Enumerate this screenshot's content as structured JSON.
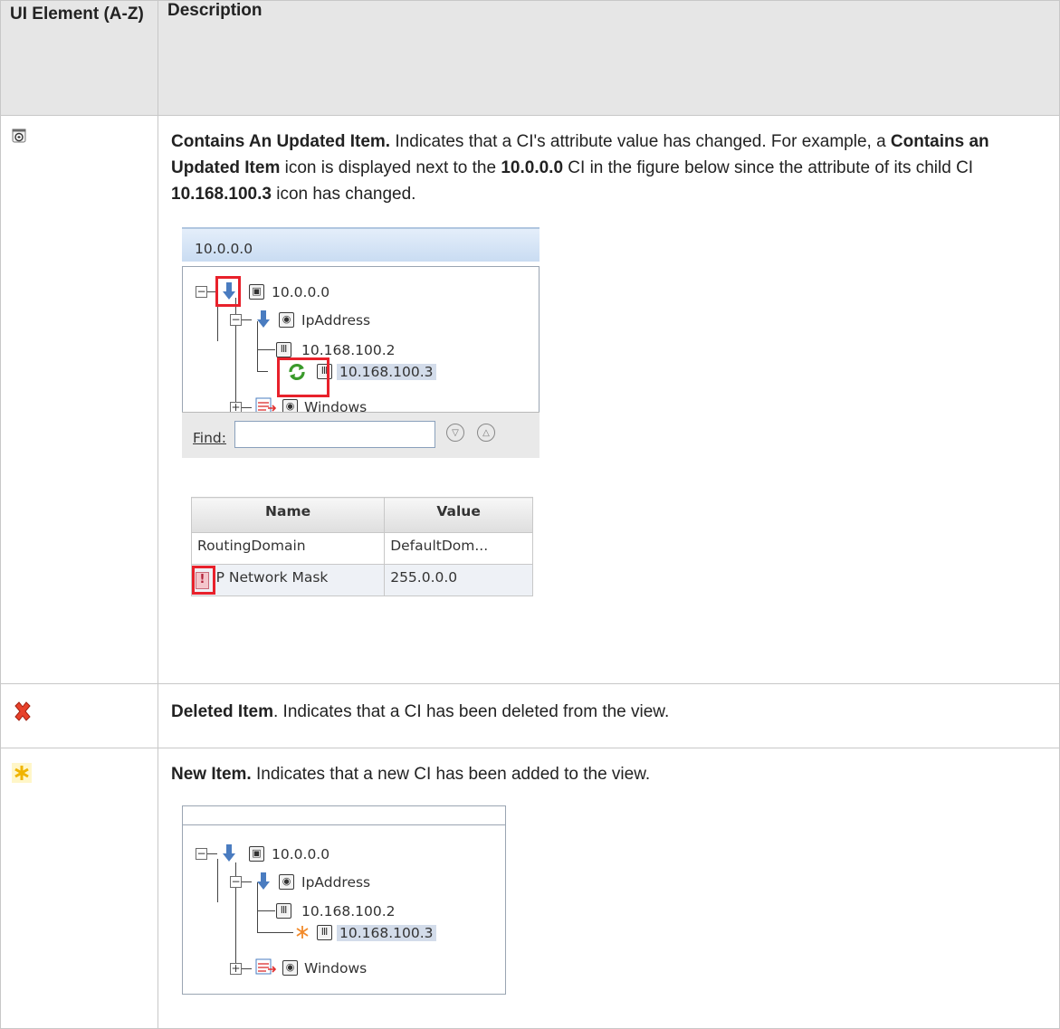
{
  "header": {
    "col1": "UI Element (A-Z)",
    "col2": "Description"
  },
  "rows": [
    {
      "icon": "contains-updated-item-icon",
      "title": "Contains An Updated Item.",
      "text_parts": [
        " Indicates that a CI's attribute value has changed. For example, a ",
        "Contains an Updated Item",
        " icon is displayed next to the ",
        "10.0.0.0",
        " CI in the figure below since the attribute of its child CI ",
        "10.168.100.3",
        " icon has changed."
      ],
      "figure": {
        "title": "10.0.0.0",
        "tree": [
          "10.0.0.0",
          "IpAddress",
          "10.168.100.2",
          "10.168.100.3",
          "Windows"
        ],
        "find_label": "Find:",
        "table_headers": [
          "Name",
          "Value"
        ],
        "table_rows": [
          [
            "RoutingDomain",
            "DefaultDom..."
          ],
          [
            "IP Network Mask",
            "255.0.0.0"
          ]
        ]
      }
    },
    {
      "icon": "deleted-item-icon",
      "title": "Deleted Item",
      "text": ". Indicates that a CI has been deleted from the view."
    },
    {
      "icon": "new-item-icon",
      "title": "New Item.",
      "text": " Indicates that a new CI has been added to the view.",
      "figure": {
        "tree": [
          "10.0.0.0",
          "IpAddress",
          "10.168.100.2",
          "10.168.100.3",
          "Windows"
        ]
      }
    }
  ],
  "colors": {
    "highlight": "#e8212b",
    "header_bg": "#e6e6e6",
    "selection": "#d3dcea"
  }
}
